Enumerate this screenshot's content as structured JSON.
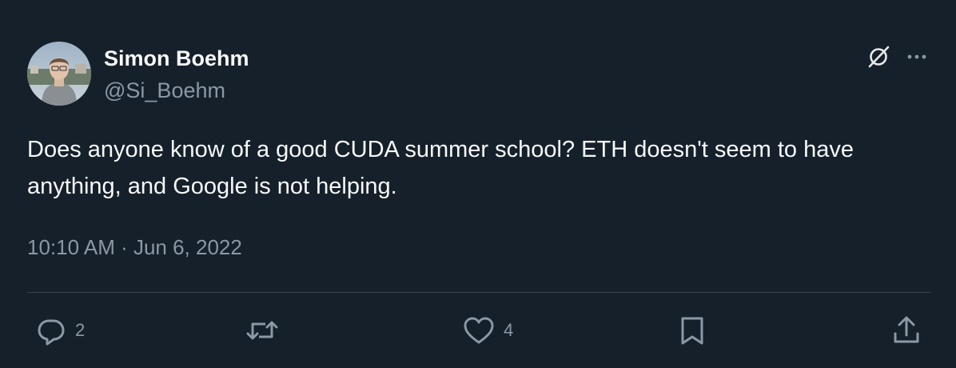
{
  "author": {
    "display_name": "Simon Boehm",
    "handle": "@Si_Boehm"
  },
  "tweet": {
    "text": "Does anyone know of a good CUDA summer school? ETH doesn't seem to have anything, and Google is not helping.",
    "timestamp": "10:10 AM · Jun 6, 2022"
  },
  "actions": {
    "reply_count": "2",
    "like_count": "4"
  },
  "icons": {
    "grok": "grok-icon",
    "more": "more-icon",
    "reply": "reply-icon",
    "retweet": "retweet-icon",
    "like": "heart-icon",
    "bookmark": "bookmark-icon",
    "share": "share-icon"
  },
  "colors": {
    "background": "#15202b",
    "primary_text": "#f7f9f9",
    "secondary_text": "#8b98a5",
    "divider": "#38444d"
  }
}
